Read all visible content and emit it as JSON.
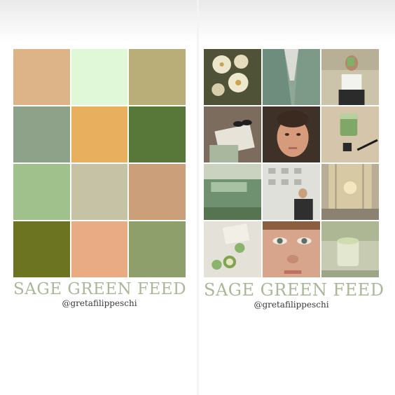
{
  "left_panel": {
    "swatches": [
      {
        "color": "#dcb487"
      },
      {
        "color": "#e0f8d7"
      },
      {
        "color": "#b9ad78"
      },
      {
        "color": "#8ea189"
      },
      {
        "color": "#e8af5f"
      },
      {
        "color": "#58783a"
      },
      {
        "color": "#a0c18c"
      },
      {
        "color": "#c5c2a6"
      },
      {
        "color": "#cb9f7a"
      },
      {
        "color": "#6d7421"
      },
      {
        "color": "#e8ab84"
      },
      {
        "color": "#8e9f6b"
      }
    ],
    "title": "SAGE GREEN FEED",
    "handle": "@gretafilippeschi"
  },
  "right_panel": {
    "photos": [
      {
        "subject": "white flowers",
        "colors": [
          "#5a5a3c",
          "#e9e4cf"
        ]
      },
      {
        "subject": "green blazer",
        "colors": [
          "#9fb3a2",
          "#6e8f7e"
        ]
      },
      {
        "subject": "woman drinking matcha",
        "colors": [
          "#c9c2a9",
          "#8bb36d"
        ]
      },
      {
        "subject": "books and sunglasses",
        "colors": [
          "#8a7a6a",
          "#e6e1d6"
        ]
      },
      {
        "subject": "face portrait",
        "colors": [
          "#4a3a2e",
          "#d9a184"
        ]
      },
      {
        "subject": "iced matcha",
        "colors": [
          "#d6c7ad",
          "#7ea768"
        ]
      },
      {
        "subject": "vintage green car",
        "colors": [
          "#8faa8a",
          "#55744f"
        ]
      },
      {
        "subject": "woman by building",
        "colors": [
          "#dcdcd6",
          "#3c3c3c"
        ]
      },
      {
        "subject": "sunset window",
        "colors": [
          "#c4b8a2",
          "#e9d9b3"
        ]
      },
      {
        "subject": "bed with book and apples",
        "colors": [
          "#e6e4dc",
          "#8ab46b"
        ]
      },
      {
        "subject": "eyes close-up",
        "colors": [
          "#d7a88e",
          "#5b6f66"
        ]
      },
      {
        "subject": "matcha latte",
        "colors": [
          "#bcc4a6",
          "#e2e6cf"
        ]
      }
    ],
    "title": "SAGE GREEN FEED",
    "handle": "@gretafilippeschi"
  }
}
